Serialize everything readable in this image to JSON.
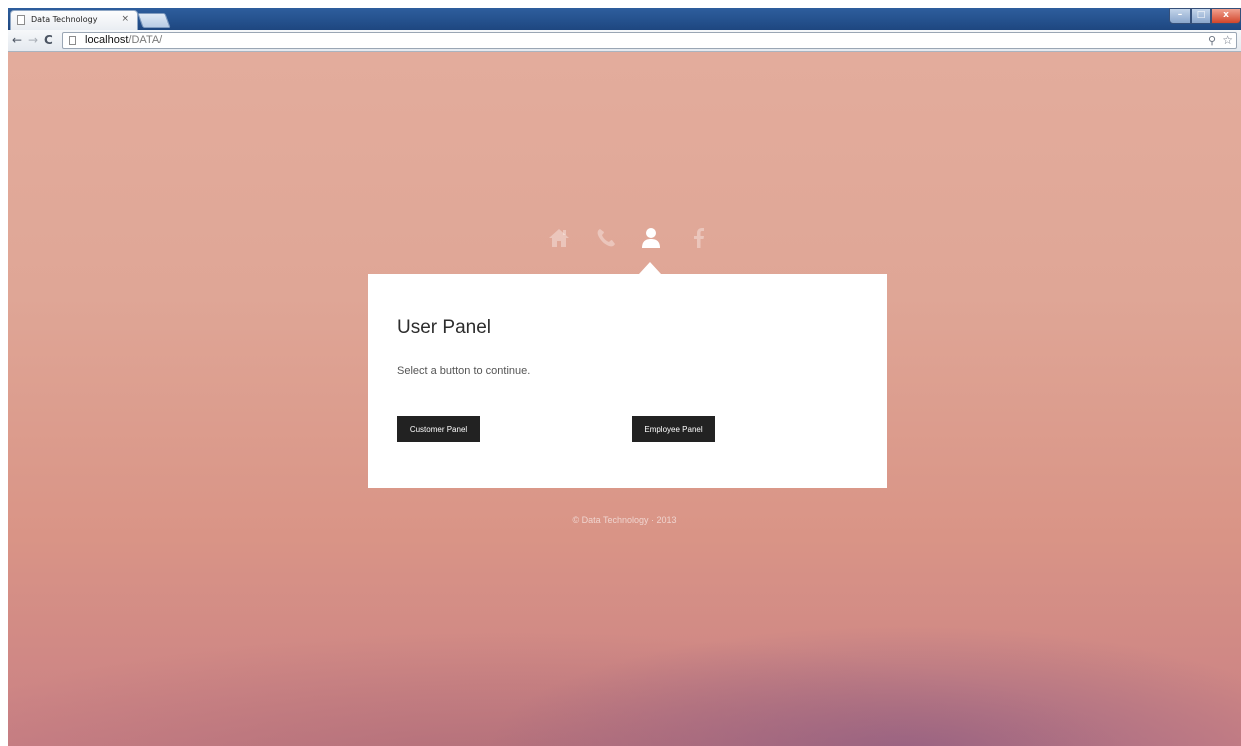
{
  "browser": {
    "tab_title": "Data Technology",
    "tab_close": "×",
    "url_host": "localhost",
    "url_path": "/DATA/",
    "back_icon": "←",
    "forward_icon": "→",
    "reload_icon": "C",
    "zoom_icon": "⚲",
    "star_icon": "☆",
    "window_controls": {
      "minimize": "–",
      "maximize": "□",
      "close": "x"
    }
  },
  "nav_icons": [
    "home-icon",
    "phone-icon",
    "user-icon",
    "facebook-icon"
  ],
  "panel": {
    "title": "User Panel",
    "subtitle": "Select a button to continue.",
    "buttons": [
      {
        "label": "Customer Panel"
      },
      {
        "label": "Employee Panel"
      }
    ]
  },
  "footer": {
    "text": "© Data Technology  ·  2013"
  },
  "colors": {
    "background_top": "#e3ac9c",
    "background_bottom": "#c98084",
    "panel": "#ffffff",
    "button": "#222222"
  }
}
